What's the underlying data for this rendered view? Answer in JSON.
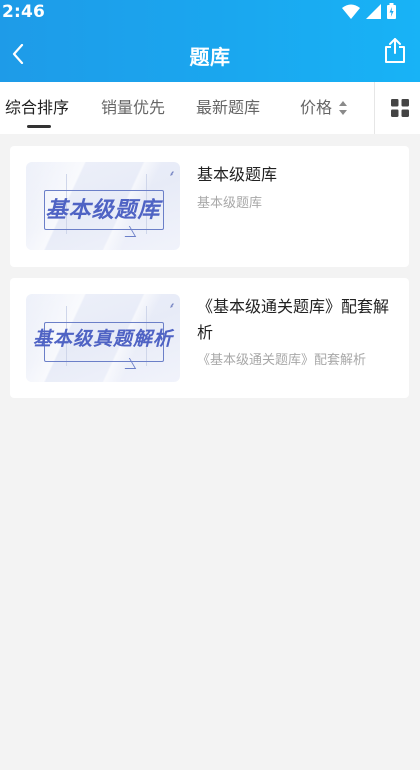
{
  "status": {
    "time": "2:46"
  },
  "header": {
    "title": "题库"
  },
  "sort_tabs": [
    {
      "label": "综合排序",
      "active": true
    },
    {
      "label": "销量优先",
      "active": false
    },
    {
      "label": "最新题库",
      "active": false
    },
    {
      "label": "价格",
      "active": false
    }
  ],
  "items": [
    {
      "thumb_text": "基本级题库",
      "title": "基本级题库",
      "subtitle": "基本级题库"
    },
    {
      "thumb_text": "基本级真题解析",
      "title": "《基本级通关题库》配套解析",
      "subtitle": "《基本级通关题库》配套解析"
    }
  ],
  "colors": {
    "header_start": "#1e9be8",
    "header_end": "#18b3f6",
    "thumb_text": "#4f63c4"
  },
  "icons": [
    "back-arrow-icon",
    "share-icon",
    "sort-arrows-icon",
    "grid-view-icon",
    "wifi-icon",
    "signal-icon",
    "battery-icon"
  ]
}
